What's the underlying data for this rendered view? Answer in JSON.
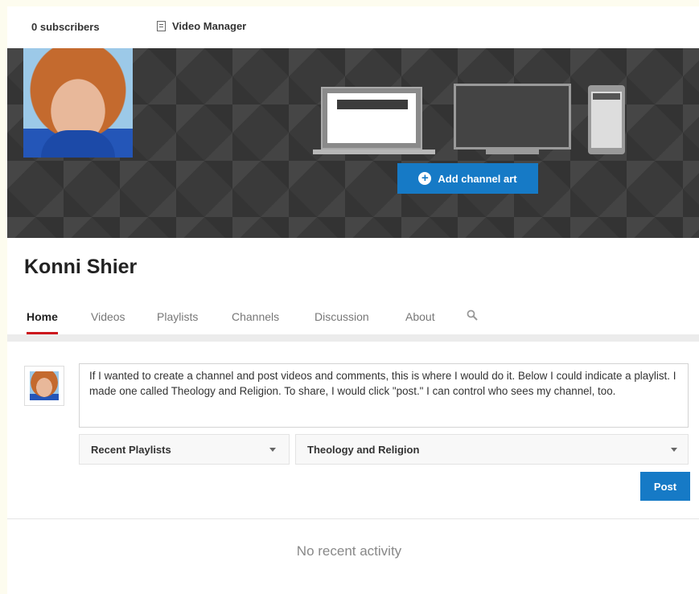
{
  "topbar": {
    "subscribers": "0 subscribers",
    "video_manager": "Video Manager"
  },
  "banner": {
    "add_channel_art": "Add channel art"
  },
  "channel": {
    "name": "Konni Shier"
  },
  "tabs": [
    {
      "label": "Home",
      "active": true
    },
    {
      "label": "Videos"
    },
    {
      "label": "Playlists"
    },
    {
      "label": "Channels"
    },
    {
      "label": "Discussion"
    },
    {
      "label": "About"
    }
  ],
  "post": {
    "text": "If I wanted to create a channel and post videos and comments, this is where I would do it. Below I could indicate a playlist. I made one called Theology and Religion. To share, I would click \"post.\" I can control who sees my channel, too.",
    "type_select": "Recent Playlists",
    "playlist_select": "Theology and Religion",
    "post_button": "Post"
  },
  "activity": {
    "empty_text": "No recent activity"
  },
  "colors": {
    "accent": "#167ac6",
    "active_tab_underline": "#cc181e"
  }
}
